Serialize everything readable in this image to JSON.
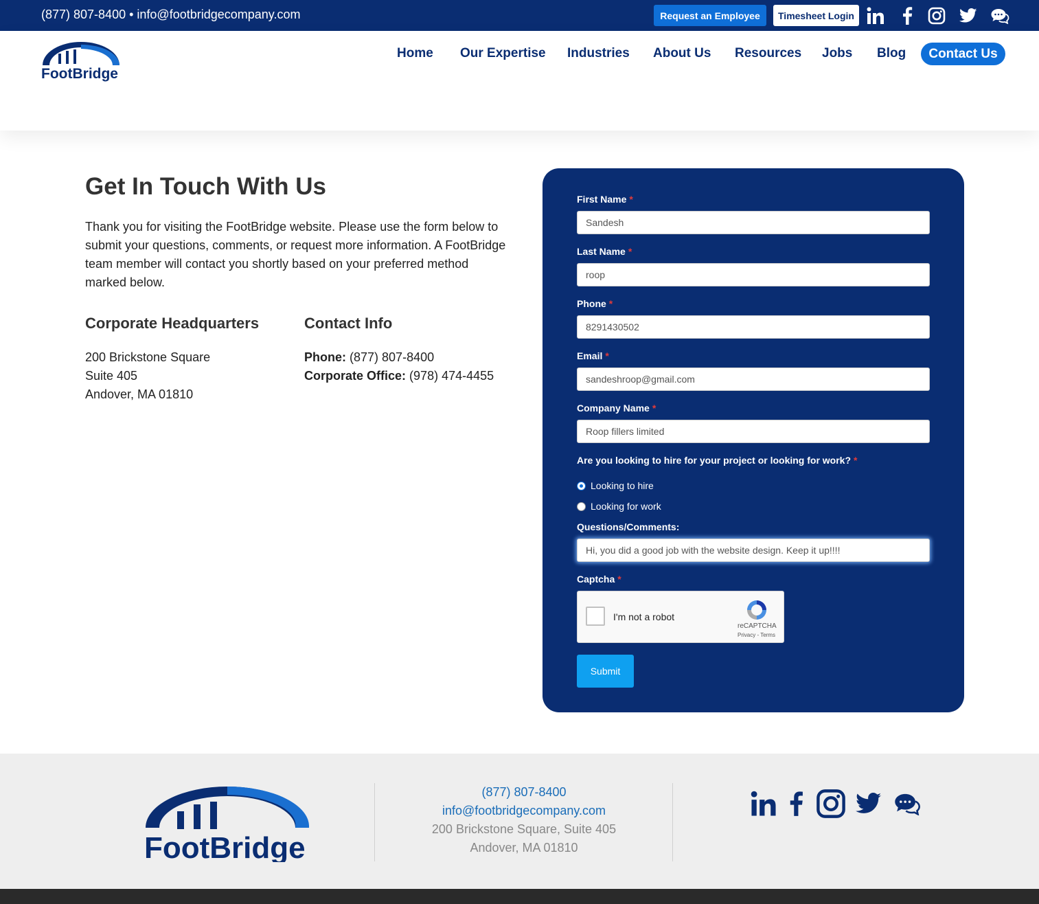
{
  "topbar": {
    "contact_line": "(877) 807-8400 • info@footbridgecompany.com",
    "request_button": "Request an Employee",
    "timesheet_button": "Timesheet Login",
    "social_icons": [
      "linkedin-icon",
      "facebook-icon",
      "instagram-icon",
      "twitter-icon",
      "chat-icon"
    ]
  },
  "brand": {
    "logo_text": "FootBridge",
    "primary_color": "#0a2d72",
    "accent_color": "#0f6fd8"
  },
  "nav": {
    "items": [
      "Home",
      "Our Expertise",
      "Industries",
      "About Us",
      "Resources",
      "Jobs",
      "Blog"
    ],
    "cta": "Contact Us"
  },
  "main": {
    "title": "Get In Touch With Us",
    "intro": "Thank you for visiting the FootBridge website. Please use the form below to submit your questions, comments, or request more information. A FootBridge team member will contact you shortly based on your preferred method marked below.",
    "hq_heading": "Corporate Headquarters",
    "hq_lines": [
      "200 Brickstone Square",
      "Suite 405",
      "Andover, MA 01810"
    ],
    "contact_heading": "Contact Info",
    "phone_label": "Phone:",
    "phone_value": "(877) 807-8400",
    "office_label": "Corporate Office:",
    "office_value": "(978) 474-4455"
  },
  "form": {
    "first_name_label": "First Name",
    "first_name_value": "Sandesh",
    "last_name_label": "Last Name",
    "last_name_value": "roop",
    "phone_label": "Phone",
    "phone_value": "8291430502",
    "email_label": "Email",
    "email_value": "sandeshroop@gmail.com",
    "company_label": "Company Name",
    "company_value": "Roop fillers limited",
    "required_mark": "*",
    "question_label": "Are you looking to hire for your project or looking for work?",
    "option_hire": "Looking to hire",
    "option_work": "Looking for work",
    "selected_option": "Looking to hire",
    "comments_label": "Questions/Comments:",
    "comments_value": "Hi, you did a good job with the website design. Keep it up!!!!",
    "captcha_label": "Captcha",
    "captcha_text": "I'm not a robot",
    "captcha_brand": "reCAPTCHA",
    "captcha_terms": "Privacy - Terms",
    "submit_label": "Submit"
  },
  "footer": {
    "logo_text": "FootBridge",
    "phone": "(877) 807-8400",
    "email": "info@footbridgecompany.com",
    "address_line1": "200 Brickstone Square, Suite 405",
    "address_line2": "Andover, MA 01810",
    "social_icons": [
      "linkedin-icon",
      "facebook-icon",
      "instagram-icon",
      "twitter-icon",
      "chat-icon"
    ]
  }
}
